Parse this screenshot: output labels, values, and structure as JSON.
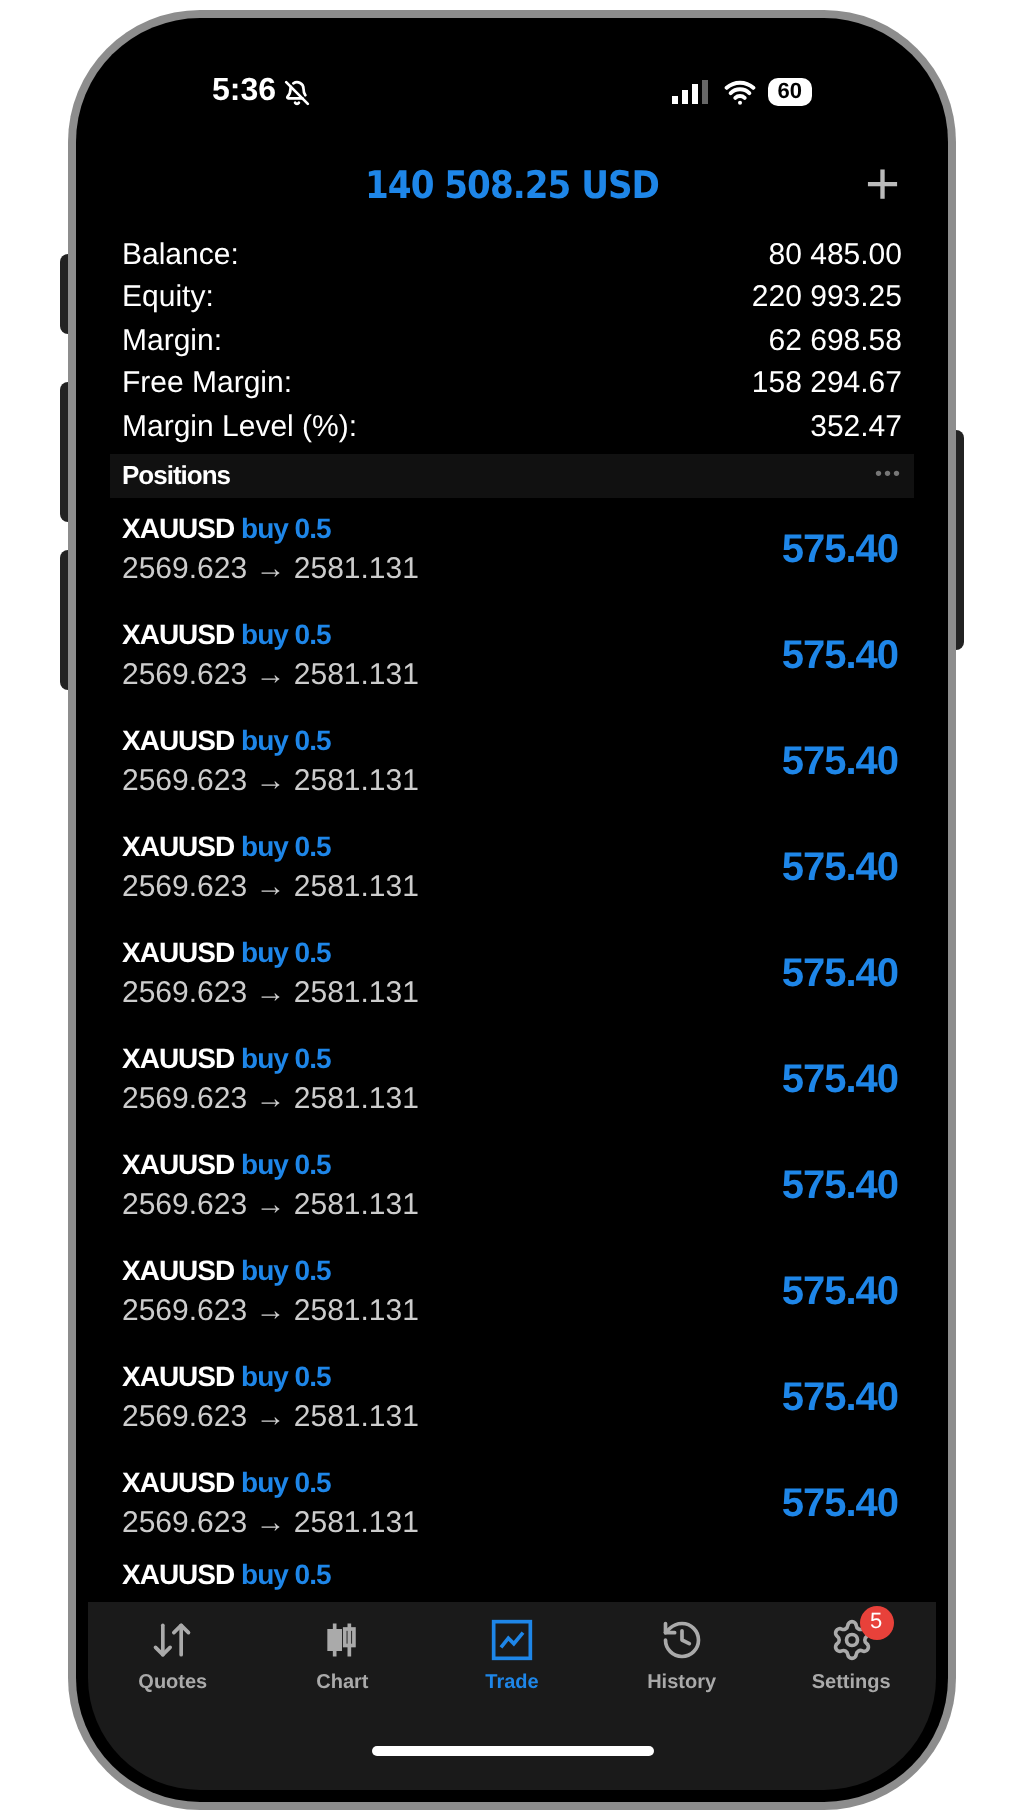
{
  "status_bar": {
    "time": "5:36",
    "silent": true,
    "battery": "60"
  },
  "header": {
    "total": "140 508.25 USD",
    "add_icon": "+"
  },
  "summary": [
    {
      "label": "Balance:",
      "value": "80 485.00"
    },
    {
      "label": "Equity:",
      "value": "220 993.25"
    },
    {
      "label": "Margin:",
      "value": "62 698.58"
    },
    {
      "label": "Free Margin:",
      "value": "158 294.67"
    },
    {
      "label": "Margin Level (%):",
      "value": "352.47"
    }
  ],
  "positions": {
    "title": "Positions",
    "more": "•••",
    "rows": [
      {
        "symbol": "XAUUSD",
        "side": "buy 0.5",
        "prices": "2569.623 → 2581.131",
        "profit": "575.40"
      },
      {
        "symbol": "XAUUSD",
        "side": "buy 0.5",
        "prices": "2569.623 → 2581.131",
        "profit": "575.40"
      },
      {
        "symbol": "XAUUSD",
        "side": "buy 0.5",
        "prices": "2569.623 → 2581.131",
        "profit": "575.40"
      },
      {
        "symbol": "XAUUSD",
        "side": "buy 0.5",
        "prices": "2569.623 → 2581.131",
        "profit": "575.40"
      },
      {
        "symbol": "XAUUSD",
        "side": "buy 0.5",
        "prices": "2569.623 → 2581.131",
        "profit": "575.40"
      },
      {
        "symbol": "XAUUSD",
        "side": "buy 0.5",
        "prices": "2569.623 → 2581.131",
        "profit": "575.40"
      },
      {
        "symbol": "XAUUSD",
        "side": "buy 0.5",
        "prices": "2569.623 → 2581.131",
        "profit": "575.40"
      },
      {
        "symbol": "XAUUSD",
        "side": "buy 0.5",
        "prices": "2569.623 → 2581.131",
        "profit": "575.40"
      },
      {
        "symbol": "XAUUSD",
        "side": "buy 0.5",
        "prices": "2569.623 → 2581.131",
        "profit": "575.40"
      },
      {
        "symbol": "XAUUSD",
        "side": "buy 0.5",
        "prices": "2569.623 → 2581.131",
        "profit": "575.40"
      },
      {
        "symbol": "XAUUSD",
        "side": "buy 0.5"
      }
    ]
  },
  "tabs": [
    {
      "kind": "quotes",
      "label": "Quotes",
      "selected": false
    },
    {
      "kind": "chart",
      "label": "Chart",
      "selected": false
    },
    {
      "kind": "trade",
      "label": "Trade",
      "selected": true
    },
    {
      "kind": "history",
      "label": "History",
      "selected": false
    },
    {
      "kind": "settings",
      "label": "Settings",
      "selected": false,
      "badge": "5"
    }
  ]
}
